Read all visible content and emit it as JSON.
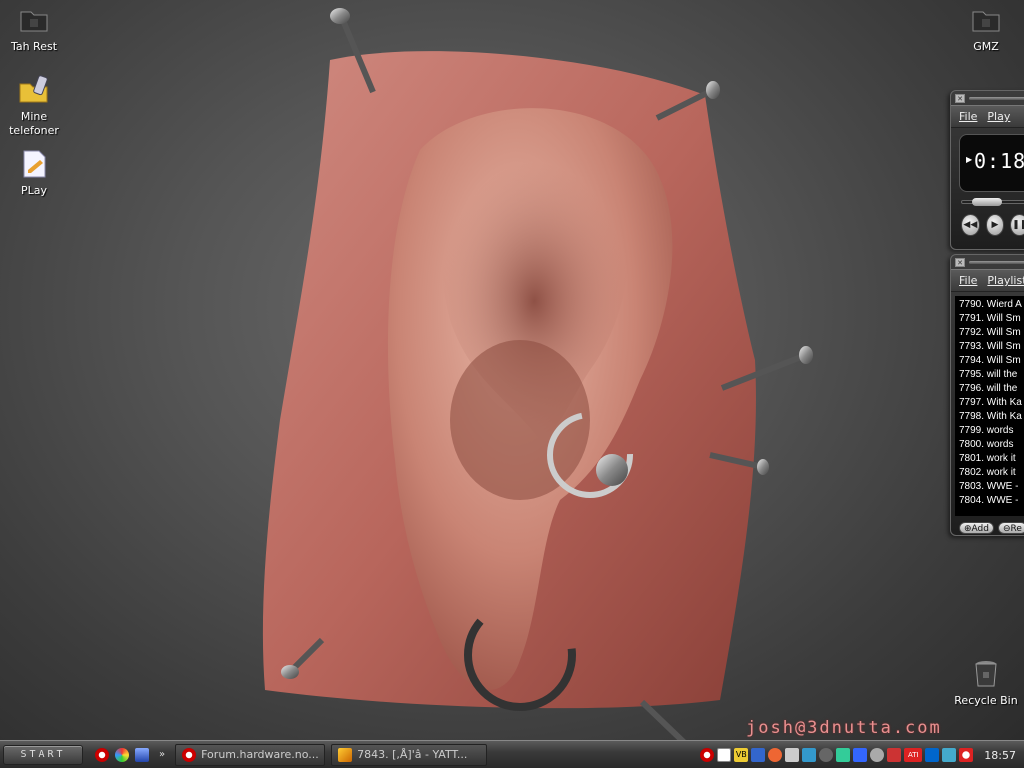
{
  "desktop": {
    "icons_left": [
      {
        "label": "Tah Rest",
        "icon": "folder-icon"
      },
      {
        "label": "Mine telefoner",
        "icon": "folder-phone-icon"
      },
      {
        "label": "PLay",
        "icon": "playlist-file-icon"
      }
    ],
    "icons_right": [
      {
        "label": "GMZ",
        "icon": "folder-icon"
      },
      {
        "label": "Recycle Bin",
        "icon": "recycle-bin-icon"
      }
    ],
    "wallpaper_signature": "josh@3dnutta.com"
  },
  "winamp": {
    "main_menu": [
      "File",
      "Play"
    ],
    "time": "0:18",
    "playlist_menu": [
      "File",
      "Playlist"
    ],
    "playlist_rows": [
      "7790. Wierd A",
      "7791. Will Sm",
      "7792. Will Sm",
      "7793. Will Sm",
      "7794. Will Sm",
      "7795. will the",
      "7796. will the",
      "7797. With Ka",
      "7798. With Ka",
      "7799. words",
      "7800. words",
      "7801. work it",
      "7802. work it",
      "7803. WWE -",
      "7804. WWE -"
    ],
    "add_label": "Add",
    "rem_label": "Re"
  },
  "taskbar": {
    "start_label": "START",
    "tasks": [
      {
        "label": "Forum.hardware.no..."
      },
      {
        "label": "7843. [,Å]'â - YATT..."
      }
    ],
    "clock": "18:57"
  },
  "colors": {
    "signature": "#e89090",
    "taskbar_bg": "#3a3a3a"
  }
}
